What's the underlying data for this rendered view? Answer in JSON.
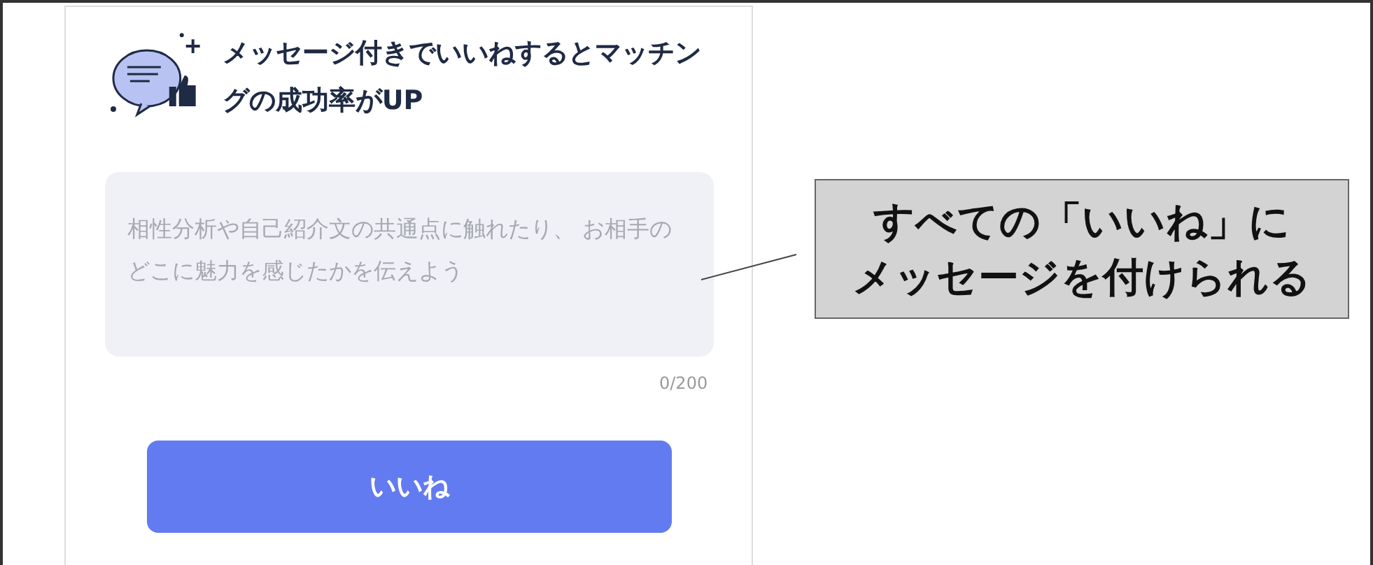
{
  "card": {
    "title": "メッセージ付きでいいねするとマッチングの成功率がUP",
    "message": {
      "placeholder": "相性分析や自己紹介文の共通点に触れたり、 お相手のどこに魅力を感じたかを伝えよう",
      "counter": "0/200"
    },
    "button": "いいね"
  },
  "callout": {
    "lines": [
      "すべての「いいね」に",
      "メッセージを付けられる"
    ]
  }
}
